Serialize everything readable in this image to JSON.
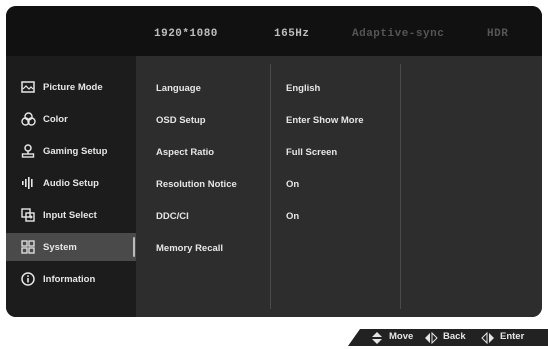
{
  "status_bar": {
    "resolution": "1920*1080",
    "refresh_rate": "165Hz",
    "adaptive_sync": "Adaptive-sync",
    "hdr": "HDR"
  },
  "sidebar": {
    "items": [
      {
        "label": "Picture Mode",
        "icon": "picture-mode-icon"
      },
      {
        "label": "Color",
        "icon": "color-icon"
      },
      {
        "label": "Gaming Setup",
        "icon": "gaming-setup-icon"
      },
      {
        "label": "Audio Setup",
        "icon": "audio-setup-icon"
      },
      {
        "label": "Input Select",
        "icon": "input-select-icon"
      },
      {
        "label": "System",
        "icon": "system-icon",
        "selected": true
      },
      {
        "label": "Information",
        "icon": "information-icon"
      }
    ]
  },
  "settings": [
    {
      "name": "Language",
      "value": "English"
    },
    {
      "name": "OSD Setup",
      "value": "Enter Show More"
    },
    {
      "name": "Aspect Ratio",
      "value": "Full Screen"
    },
    {
      "name": "Resolution Notice",
      "value": "On"
    },
    {
      "name": "DDC/CI",
      "value": "On"
    },
    {
      "name": "Memory Recall",
      "value": ""
    }
  ],
  "footer": {
    "move": "Move",
    "back": "Back",
    "enter": "Enter"
  },
  "colors": {
    "panel": "#2d2d2d",
    "sidebar": "#1c1c1c",
    "topbar": "#111111",
    "selected": "#4a4a4a",
    "text": "#e6e6e6"
  }
}
